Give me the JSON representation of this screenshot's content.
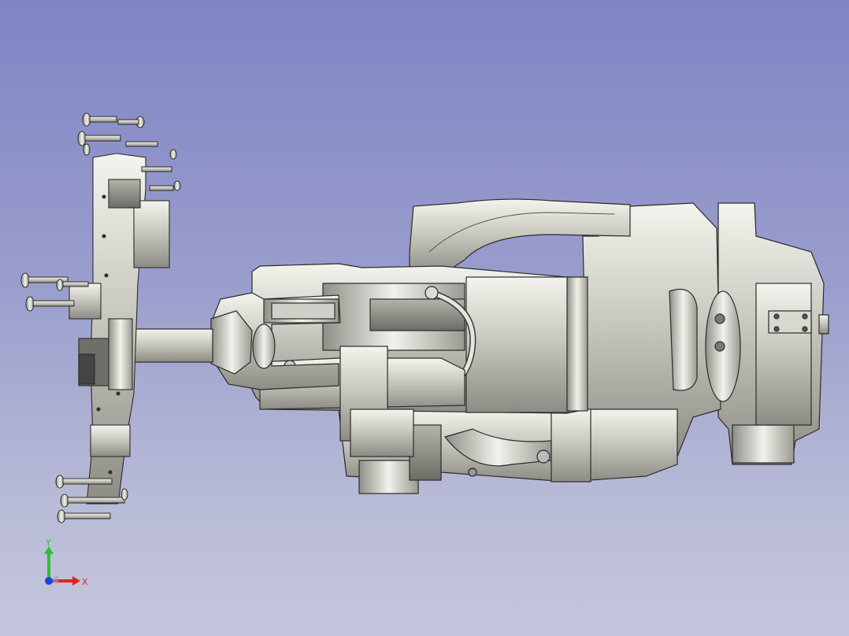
{
  "viewport": {
    "background_top": "#7f84c4",
    "background_bottom": "#c4c6dc"
  },
  "model": {
    "description_icon": "robot-arm-with-gripper-model"
  },
  "triad": {
    "x_label": "X",
    "y_label": "Y",
    "x_color": "#e32020",
    "y_color": "#2fbf2f",
    "z_color": "#2040e0"
  }
}
